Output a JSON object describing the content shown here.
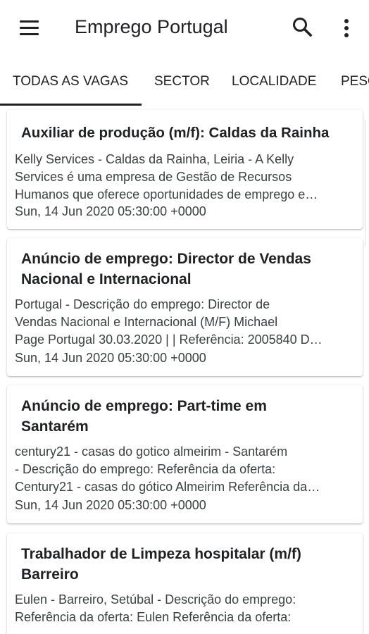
{
  "appbar": {
    "title": "Emprego Portugal",
    "menu_icon": "menu-icon",
    "search_icon": "search-icon",
    "more_icon": "more-vert-icon"
  },
  "tabs": [
    {
      "label": "TODAS AS VAGAS",
      "selected": true
    },
    {
      "label": "SECTOR",
      "selected": false
    },
    {
      "label": "LOCALIDADE",
      "selected": false
    },
    {
      "label": "PESQUISA",
      "selected": false
    }
  ],
  "jobs": [
    {
      "title_lines": [
        "Auxiliar de produção (m/f): Caldas da Rainha"
      ],
      "desc_lines": [
        "Kelly Services - Caldas da Rainha, Leiria - A Kelly",
        "Services é uma empresa de Gestão de Recursos",
        "Humanos que oferece oportunidades de emprego e…"
      ],
      "date": "Sun, 14 Jun 2020 05:30:00 +0000"
    },
    {
      "title_lines": [
        "Anúncio de emprego: Director de Vendas",
        "Nacional e Internacional"
      ],
      "desc_lines": [
        "Portugal - Descrição do emprego: Director de",
        "Vendas Nacional e Internacional (M/F) Michael",
        "Page Portugal 30.03.2020 | | Referência: 2005840 D…"
      ],
      "date": "Sun, 14 Jun 2020 05:30:00 +0000"
    },
    {
      "title_lines": [
        "Anúncio de emprego: Part-time em",
        "Santarém"
      ],
      "desc_lines": [
        "century21 - casas do gotico almeirim - Santarém",
        "- Descrição do emprego: Referência da oferta:",
        "Century21 - casas do gótico Almeirim Referência da…"
      ],
      "date": "Sun, 14 Jun 2020 05:30:00 +0000"
    },
    {
      "title_lines": [
        "Trabalhador de Limpeza hospitalar (m/f)",
        "Barreiro"
      ],
      "desc_lines": [
        "Eulen - Barreiro, Setúbal - Descrição do emprego:",
        "Referência da oferta: Eulen Referência da oferta:"
      ],
      "date": ""
    }
  ]
}
